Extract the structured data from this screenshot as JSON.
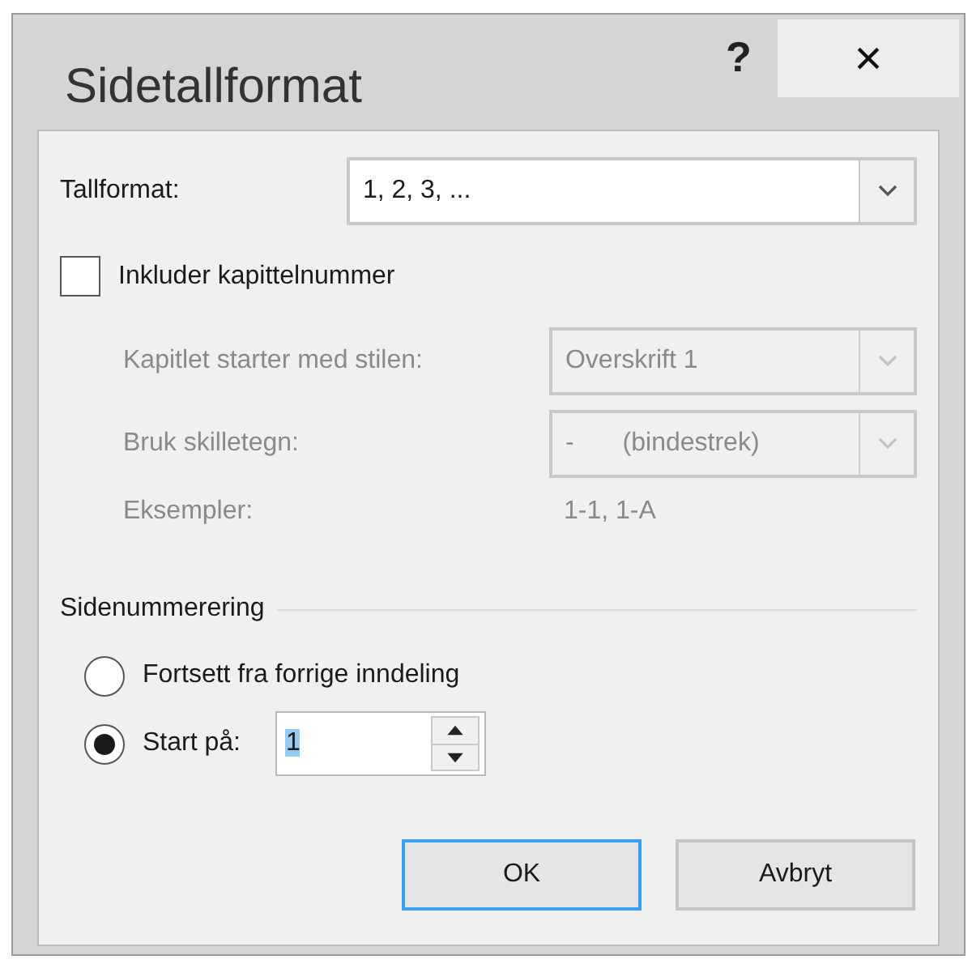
{
  "window": {
    "title": "Sidetallformat",
    "help_button": "?",
    "close_button": "×"
  },
  "number_format": {
    "label": "Tallformat:",
    "value": "1, 2, 3, ..."
  },
  "include_chapter": {
    "label": "Inkluder kapittelnummer",
    "checked": false
  },
  "chapter_fields": [
    {
      "label": "Kapitlet starter med stilen:",
      "kind": "dropdown",
      "value": "Overskrift 1",
      "disabled": true
    },
    {
      "label": "Bruk skilletegn:",
      "kind": "dropdown",
      "value": "-",
      "value_note": "(bindestrek)",
      "disabled": true
    },
    {
      "label": "Eksempler:",
      "kind": "text",
      "value": "1-1, 1-A",
      "disabled": true
    }
  ],
  "page_numbering": {
    "heading": "Sidenummerering",
    "options": [
      {
        "label": "Fortsett fra forrige inndeling",
        "selected": false
      },
      {
        "label": "Start på:",
        "selected": true,
        "value": "1",
        "highlighted": true
      }
    ]
  },
  "buttons": [
    {
      "label": "OK",
      "default": true
    },
    {
      "label": "Avbryt",
      "default": false
    }
  ]
}
